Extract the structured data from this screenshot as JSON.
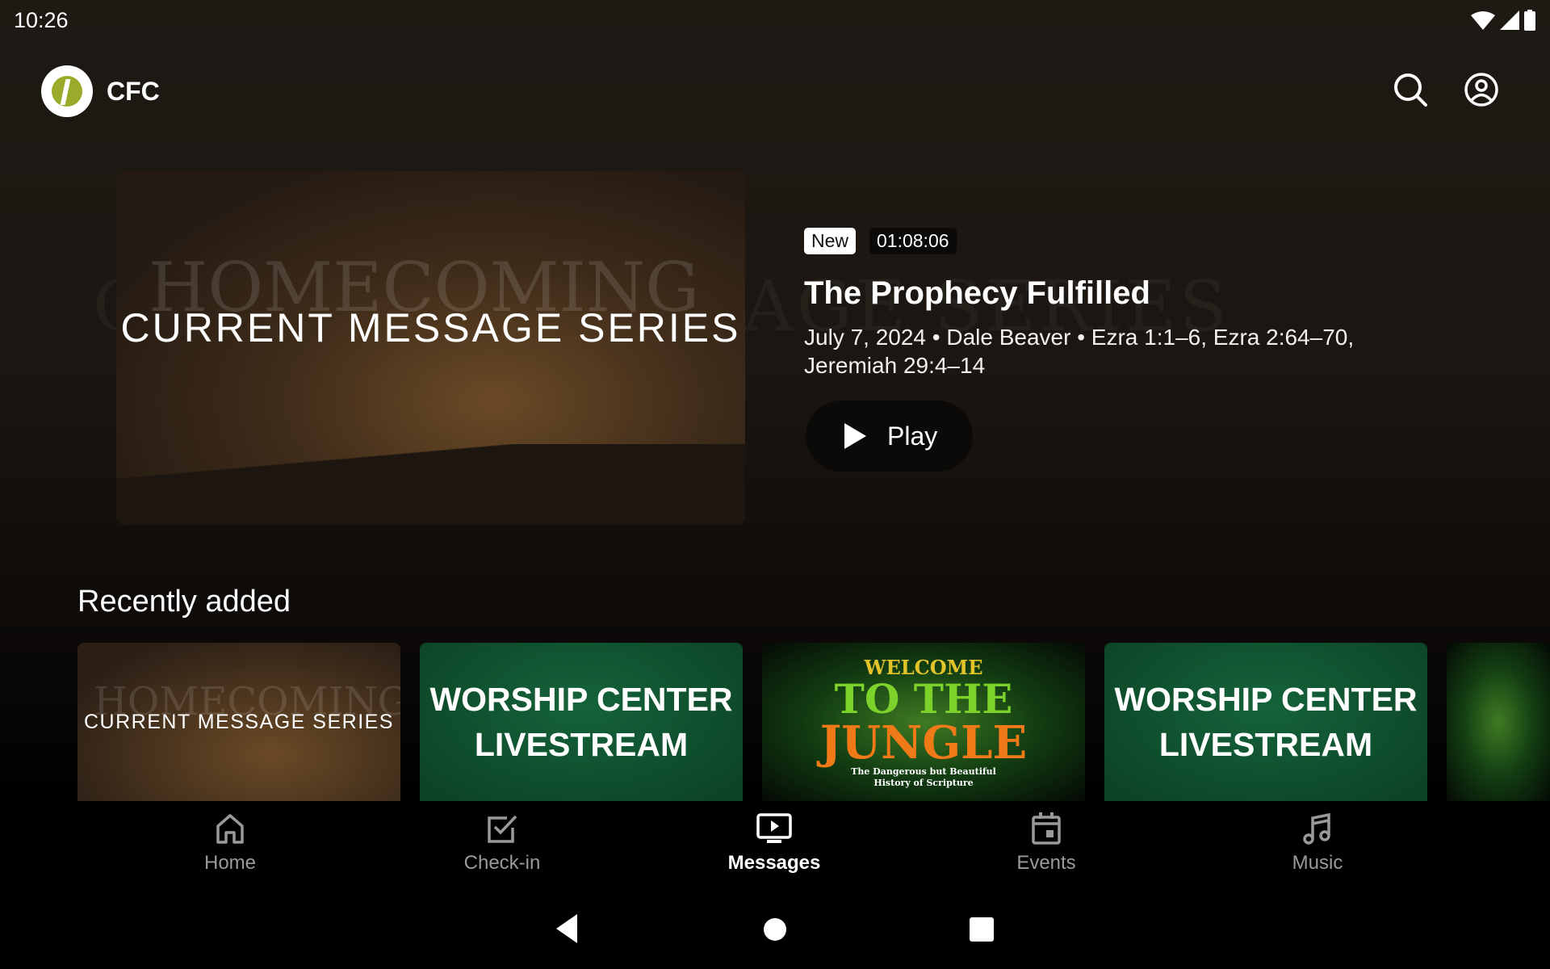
{
  "status_bar": {
    "time": "10:26",
    "icons": [
      "wifi-icon",
      "signal-icon",
      "battery-icon"
    ]
  },
  "header": {
    "brand": "CFC",
    "icons": [
      "search-icon",
      "account-icon"
    ]
  },
  "background_text": "CURRENT MESSAGE SERIES",
  "featured": {
    "image_ghost": "HOMECOMING",
    "image_title": "CURRENT MESSAGE SERIES",
    "badge": "New",
    "duration": "01:08:06",
    "title": "The Prophecy Fulfilled",
    "meta_line1": "July 7, 2024 • Dale Beaver • Ezra 1:1–6, Ezra 2:64–70,",
    "meta_line2": "Jeremiah 29:4–14",
    "play_label": "Play"
  },
  "recently_added": {
    "heading": "Recently added",
    "cards": [
      {
        "ghost": "HOMECOMING",
        "title": "CURRENT MESSAGE SERIES"
      },
      {
        "line1": "WORSHIP CENTER",
        "line2": "LIVESTREAM"
      },
      {
        "w": "WELCOME",
        "t": "TO THE",
        "j": "JUNGLE",
        "sub1": "The Dangerous but Beautiful",
        "sub2": "History of Scripture"
      },
      {
        "line1": "WORSHIP CENTER",
        "line2": "LIVESTREAM"
      }
    ]
  },
  "bottom_nav": {
    "active": "Messages",
    "items": [
      {
        "label": "Home"
      },
      {
        "label": "Check-in"
      },
      {
        "label": "Messages"
      },
      {
        "label": "Events"
      },
      {
        "label": "Music"
      }
    ]
  },
  "colors": {
    "background": "#1f1914",
    "accent_green": "#0f5530",
    "logo_green": "#9aab2b"
  }
}
